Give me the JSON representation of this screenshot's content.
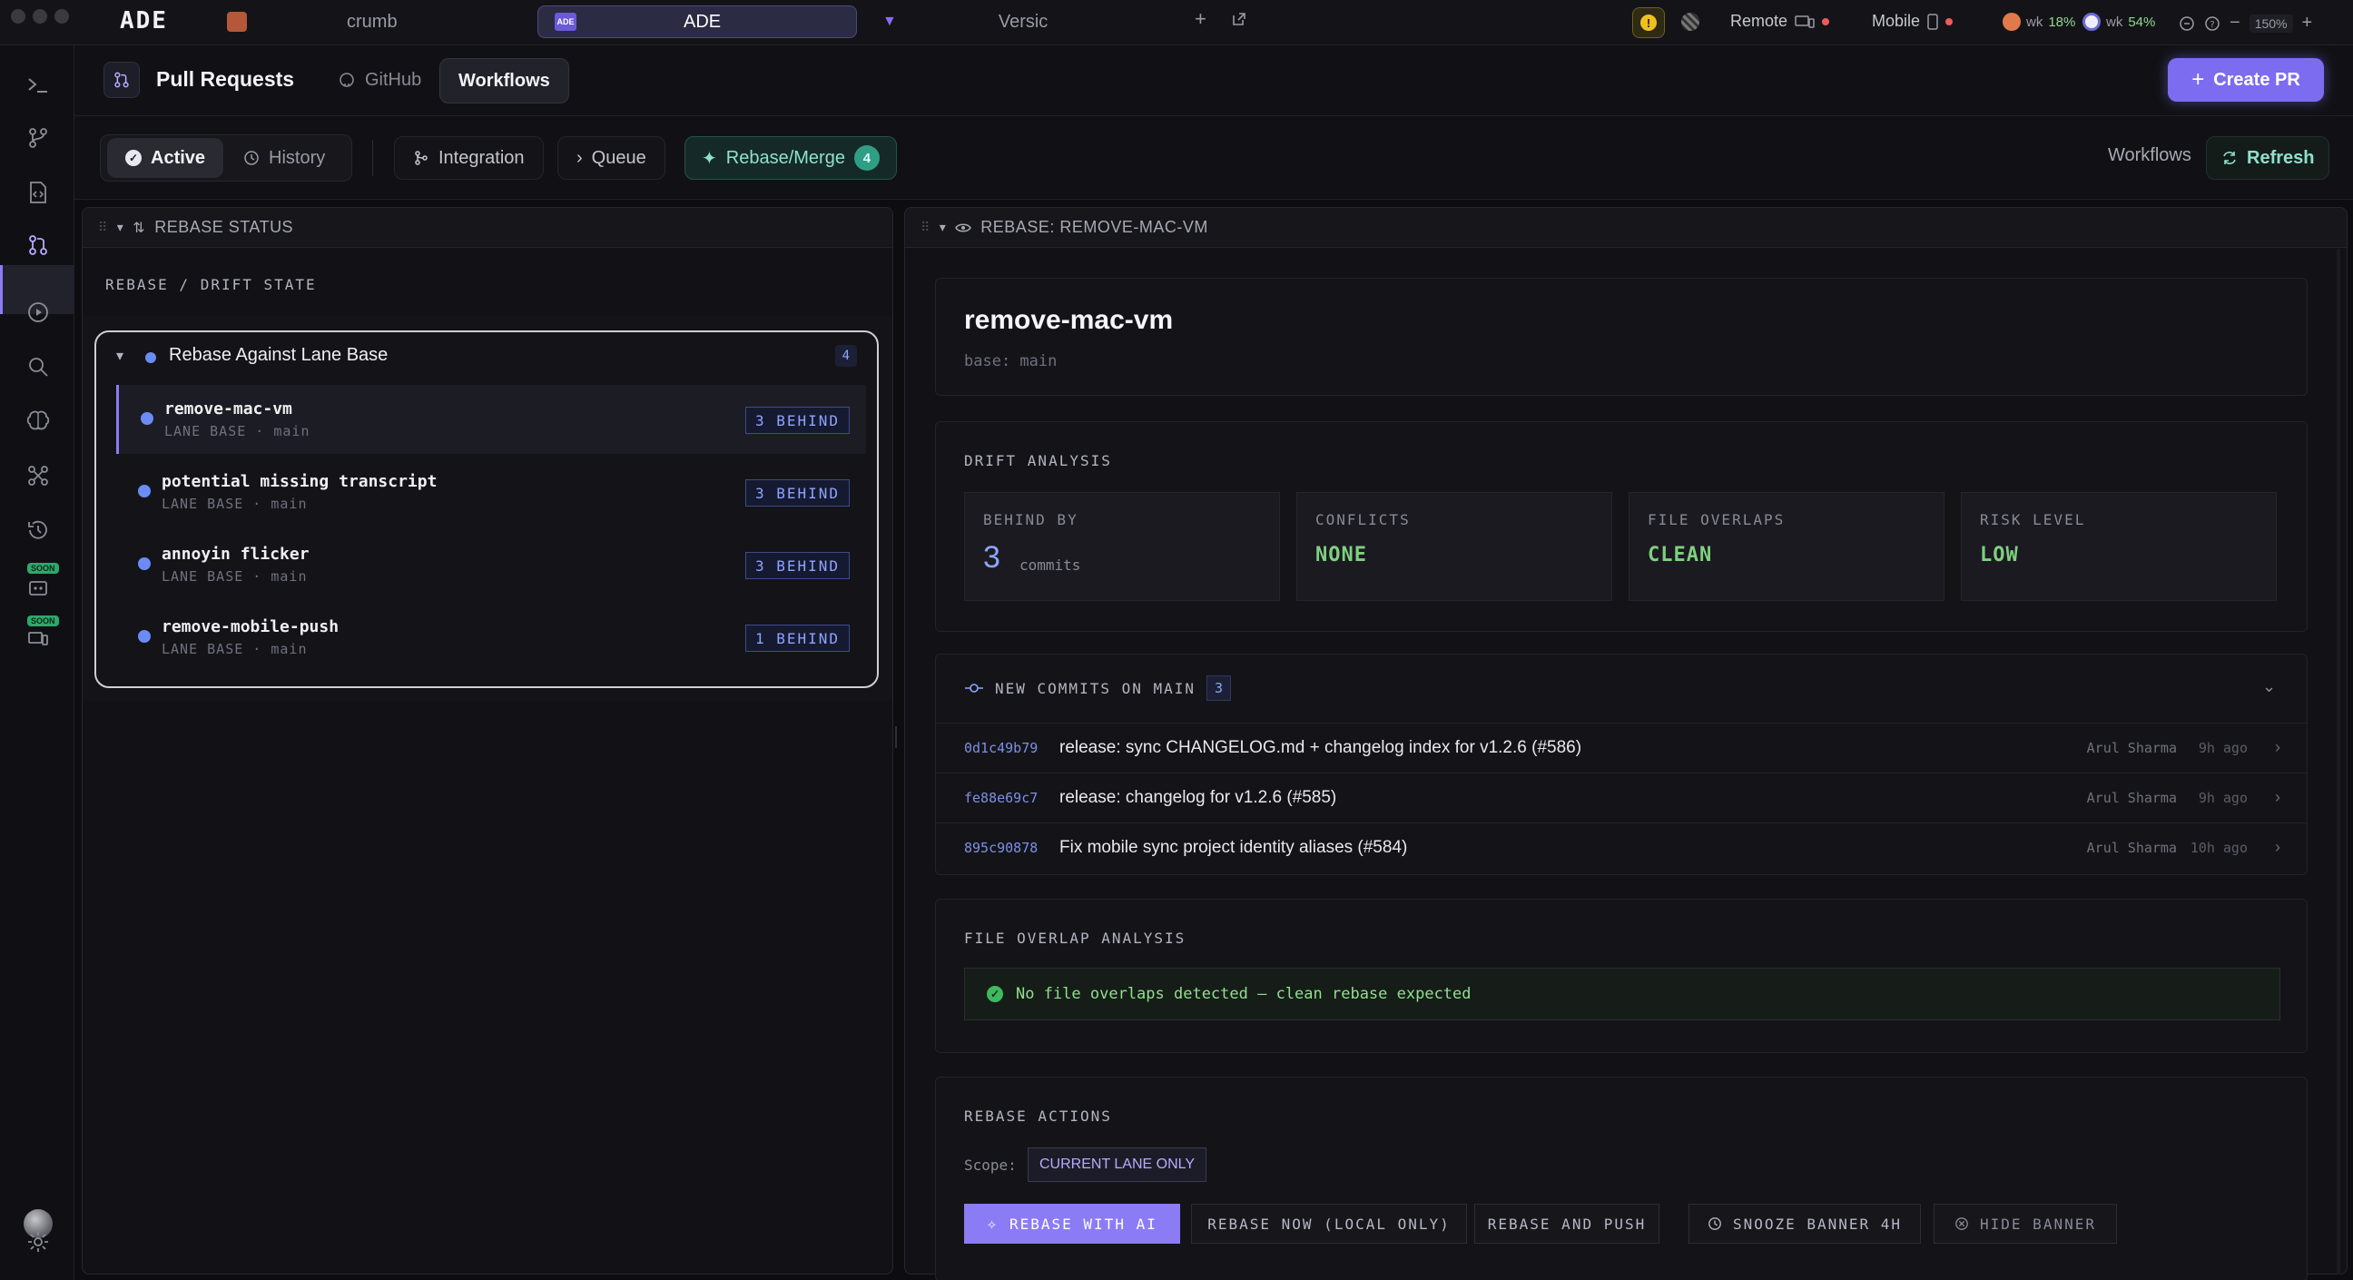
{
  "titlebar": {
    "logo": "ADE",
    "tabs": [
      {
        "label": "crumb"
      },
      {
        "label": "ADE",
        "icon_text": "ADE"
      },
      {
        "label": "Versic"
      }
    ],
    "remote_label": "Remote",
    "mobile_label": "Mobile",
    "usage": [
      {
        "label": "wk",
        "value": "18%"
      },
      {
        "label": "wk",
        "value": "54%"
      }
    ],
    "zoom": "150%"
  },
  "header": {
    "title": "Pull Requests",
    "tabs": [
      "GitHub",
      "Workflows"
    ],
    "active_tab": "Workflows",
    "create_pr_label": "Create PR"
  },
  "filters": {
    "segment": [
      "Active",
      "History"
    ],
    "views": [
      {
        "label": "Integration"
      },
      {
        "label": "Queue"
      },
      {
        "label": "Rebase/Merge",
        "count": "4"
      }
    ],
    "right_label": "Workflows",
    "refresh_label": "Refresh"
  },
  "left_panel": {
    "title": "REBASE STATUS",
    "caption": "REBASE / DRIFT STATE",
    "group": {
      "label": "Rebase Against Lane Base",
      "count": "4",
      "lanes": [
        {
          "name": "remove-mac-vm",
          "sub": "LANE BASE · main",
          "status": "3 BEHIND"
        },
        {
          "name": "potential missing transcript",
          "sub": "LANE BASE · main",
          "status": "3 BEHIND"
        },
        {
          "name": "annoyin flicker",
          "sub": "LANE BASE · main",
          "status": "3 BEHIND"
        },
        {
          "name": "remove-mobile-push",
          "sub": "LANE BASE · main",
          "status": "1 BEHIND"
        }
      ]
    }
  },
  "right_panel": {
    "title": "REBASE: REMOVE-MAC-VM",
    "branch": "remove-mac-vm",
    "base": "base: main",
    "drift": {
      "caption": "DRIFT ANALYSIS",
      "behind_label": "BEHIND BY",
      "behind_value": "3",
      "behind_unit": "commits",
      "conflicts_label": "CONFLICTS",
      "conflicts_value": "NONE",
      "overlaps_label": "FILE OVERLAPS",
      "overlaps_value": "CLEAN",
      "risk_label": "RISK LEVEL",
      "risk_value": "LOW"
    },
    "commits": {
      "caption": "NEW COMMITS ON MAIN",
      "count": "3",
      "items": [
        {
          "sha": "0d1c49b79",
          "message": "release: sync CHANGELOG.md + changelog index for v1.2.6 (#586)",
          "author": "Arul Sharma",
          "time": "9h ago"
        },
        {
          "sha": "fe88e69c7",
          "message": "release: changelog for v1.2.6 (#585)",
          "author": "Arul Sharma",
          "time": "9h ago"
        },
        {
          "sha": "895c90878",
          "message": "Fix mobile sync project identity aliases (#584)",
          "author": "Arul Sharma",
          "time": "10h ago"
        }
      ]
    },
    "overlap": {
      "caption": "FILE OVERLAP ANALYSIS",
      "message": "No file overlaps detected — clean rebase expected"
    },
    "actions": {
      "caption": "REBASE ACTIONS",
      "scope_label": "Scope:",
      "scope_value": "CURRENT LANE ONLY",
      "buttons": [
        "REBASE WITH AI",
        "REBASE NOW (LOCAL ONLY)",
        "REBASE AND PUSH",
        "SNOOZE BANNER 4H",
        "HIDE BANNER"
      ]
    }
  },
  "rail": {
    "soon_label": "SOON"
  },
  "colors": {
    "accent": "#7c6cf0",
    "lane_dot": "#6b8cf5",
    "ok_green": "#7fd07f",
    "teal": "#2f9e84"
  }
}
